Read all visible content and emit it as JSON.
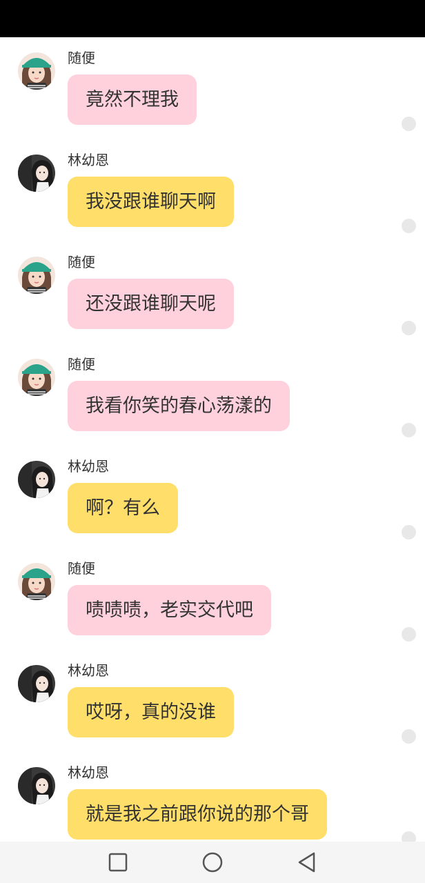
{
  "messages": [
    {
      "sender": "随便",
      "text": "竟然不理我",
      "bubble_color": "#ffd1dc",
      "avatar": "cap-girl-avatar"
    },
    {
      "sender": "林幼恩",
      "text": "我没跟谁聊天啊",
      "bubble_color": "#ffde6a",
      "avatar": "long-hair-girl-avatar"
    },
    {
      "sender": "随便",
      "text": "还没跟谁聊天呢",
      "bubble_color": "#ffd1dc",
      "avatar": "cap-girl-avatar"
    },
    {
      "sender": "随便",
      "text": "我看你笑的春心荡漾的",
      "bubble_color": "#ffd1dc",
      "avatar": "cap-girl-avatar"
    },
    {
      "sender": "林幼恩",
      "text": "啊？有么",
      "bubble_color": "#ffde6a",
      "avatar": "long-hair-girl-avatar"
    },
    {
      "sender": "随便",
      "text": "啧啧啧，老实交代吧",
      "bubble_color": "#ffd1dc",
      "avatar": "cap-girl-avatar"
    },
    {
      "sender": "林幼恩",
      "text": "哎呀，真的没谁",
      "bubble_color": "#ffde6a",
      "avatar": "long-hair-girl-avatar"
    },
    {
      "sender": "林幼恩",
      "text": "就是我之前跟你说的那个哥",
      "bubble_color": "#ffde6a",
      "avatar": "long-hair-girl-avatar"
    }
  ],
  "nav": {
    "recent_icon": "square-icon",
    "home_icon": "circle-icon",
    "back_icon": "triangle-back-icon"
  },
  "colors": {
    "status_bar": "#000000",
    "pink_bubble": "#ffd1dc",
    "yellow_bubble": "#ffde6a",
    "nav_bar": "#f5f5f5"
  }
}
